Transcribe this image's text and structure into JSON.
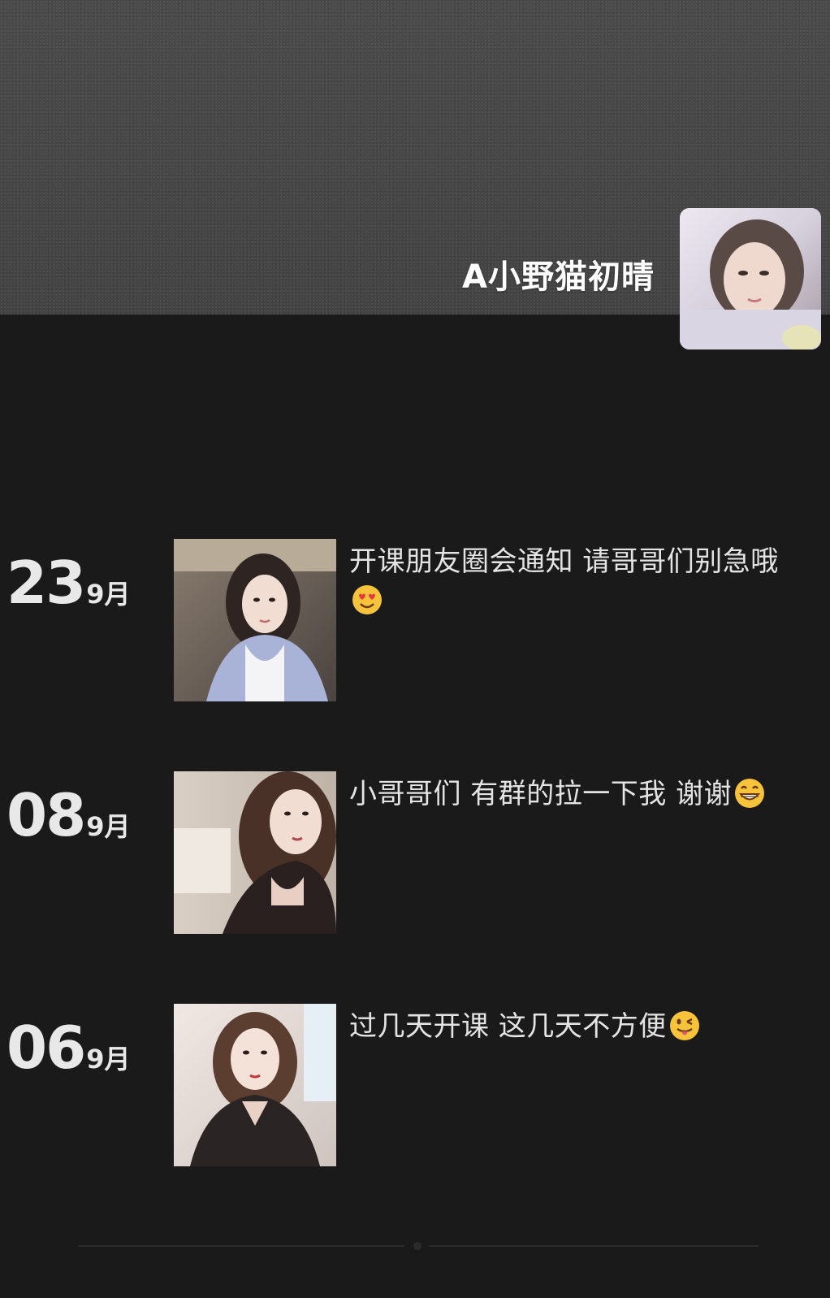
{
  "profile": {
    "name": "A小野猫初晴"
  },
  "posts": [
    {
      "day": "23",
      "month": "9月",
      "text": "开课朋友圈会通知 请哥哥们别急哦",
      "emoji": "heart-eyes-emoji"
    },
    {
      "day": "08",
      "month": "9月",
      "text": "小哥哥们 有群的拉一下我 谢谢",
      "emoji": "grinning-emoji"
    },
    {
      "day": "06",
      "month": "9月",
      "text": "过几天开课 这几天不方便",
      "emoji": "winking-tongue-emoji"
    }
  ],
  "colors": {
    "background": "#1a1a1b",
    "cover": "#474747",
    "text": "#e4e4e4"
  }
}
